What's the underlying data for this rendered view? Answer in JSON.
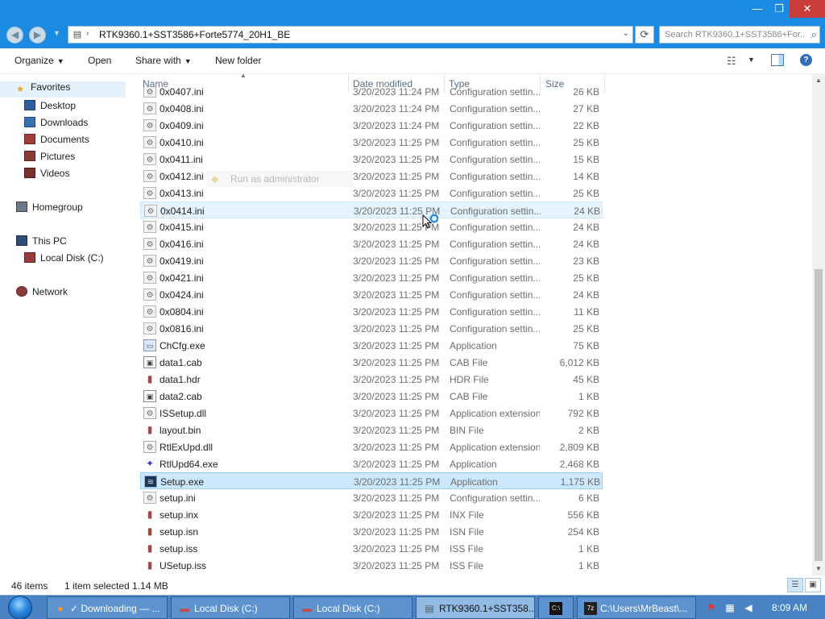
{
  "window": {
    "minimize_glyph": "—",
    "maximize_glyph": "❐",
    "close_glyph": "✕"
  },
  "address": {
    "path": "RTK9360.1+SST3586+Forte5774_20H1_BE",
    "search_placeholder": "Search RTK9360.1+SST3586+For...",
    "back_glyph": "◀",
    "forward_glyph": "▶",
    "recent_glyph": "▼",
    "separator_glyph": "›",
    "dropdown_glyph": "⌄",
    "refresh_glyph": "⟳",
    "search_glyph": "⌕"
  },
  "toolbar": {
    "organize": "Organize",
    "open": "Open",
    "share_with": "Share with",
    "new_folder": "New folder",
    "caret": "▼",
    "view_glyph": "☷",
    "help_glyph": "?"
  },
  "nav": {
    "favorites": "Favorites",
    "desktop": "Desktop",
    "downloads": "Downloads",
    "documents": "Documents",
    "pictures": "Pictures",
    "videos": "Videos",
    "homegroup": "Homegroup",
    "this_pc": "This PC",
    "local_disk": "Local Disk (C:)",
    "network": "Network"
  },
  "columns": {
    "name": "Name",
    "date_modified": "Date modified",
    "type": "Type",
    "size": "Size"
  },
  "files": [
    {
      "name": "0x0407.ini",
      "date": "3/20/2023 11:24 PM",
      "type": "Configuration settin...",
      "size": "26 KB",
      "icon": "ini"
    },
    {
      "name": "0x0408.ini",
      "date": "3/20/2023 11:24 PM",
      "type": "Configuration settin...",
      "size": "27 KB",
      "icon": "ini"
    },
    {
      "name": "0x0409.ini",
      "date": "3/20/2023 11:24 PM",
      "type": "Configuration settin...",
      "size": "22 KB",
      "icon": "ini"
    },
    {
      "name": "0x0410.ini",
      "date": "3/20/2023 11:25 PM",
      "type": "Configuration settin...",
      "size": "25 KB",
      "icon": "ini"
    },
    {
      "name": "0x0411.ini",
      "date": "3/20/2023 11:25 PM",
      "type": "Configuration settin...",
      "size": "15 KB",
      "icon": "ini"
    },
    {
      "name": "0x0412.ini",
      "date": "3/20/2023 11:25 PM",
      "type": "Configuration settin...",
      "size": "14 KB",
      "icon": "ini"
    },
    {
      "name": "0x0413.ini",
      "date": "3/20/2023 11:25 PM",
      "type": "Configuration settin...",
      "size": "25 KB",
      "icon": "ini"
    },
    {
      "name": "0x0414.ini",
      "date": "3/20/2023 11:25 PM",
      "type": "Configuration settin...",
      "size": "24 KB",
      "icon": "ini"
    },
    {
      "name": "0x0415.ini",
      "date": "3/20/2023 11:25 PM",
      "type": "Configuration settin...",
      "size": "24 KB",
      "icon": "ini"
    },
    {
      "name": "0x0416.ini",
      "date": "3/20/2023 11:25 PM",
      "type": "Configuration settin...",
      "size": "24 KB",
      "icon": "ini"
    },
    {
      "name": "0x0419.ini",
      "date": "3/20/2023 11:25 PM",
      "type": "Configuration settin...",
      "size": "23 KB",
      "icon": "ini"
    },
    {
      "name": "0x0421.ini",
      "date": "3/20/2023 11:25 PM",
      "type": "Configuration settin...",
      "size": "25 KB",
      "icon": "ini"
    },
    {
      "name": "0x0424.ini",
      "date": "3/20/2023 11:25 PM",
      "type": "Configuration settin...",
      "size": "24 KB",
      "icon": "ini"
    },
    {
      "name": "0x0804.ini",
      "date": "3/20/2023 11:25 PM",
      "type": "Configuration settin...",
      "size": "11 KB",
      "icon": "ini"
    },
    {
      "name": "0x0816.ini",
      "date": "3/20/2023 11:25 PM",
      "type": "Configuration settin...",
      "size": "25 KB",
      "icon": "ini"
    },
    {
      "name": "ChCfg.exe",
      "date": "3/20/2023 11:25 PM",
      "type": "Application",
      "size": "75 KB",
      "icon": "exe"
    },
    {
      "name": "data1.cab",
      "date": "3/20/2023 11:25 PM",
      "type": "CAB File",
      "size": "6,012 KB",
      "icon": "cab"
    },
    {
      "name": "data1.hdr",
      "date": "3/20/2023 11:25 PM",
      "type": "HDR File",
      "size": "45 KB",
      "icon": "blk"
    },
    {
      "name": "data2.cab",
      "date": "3/20/2023 11:25 PM",
      "type": "CAB File",
      "size": "1 KB",
      "icon": "cab"
    },
    {
      "name": "ISSetup.dll",
      "date": "3/20/2023 11:25 PM",
      "type": "Application extension",
      "size": "792 KB",
      "icon": "dll"
    },
    {
      "name": "layout.bin",
      "date": "3/20/2023 11:25 PM",
      "type": "BIN File",
      "size": "2 KB",
      "icon": "blk"
    },
    {
      "name": "RtlExUpd.dll",
      "date": "3/20/2023 11:25 PM",
      "type": "Application extension",
      "size": "2,809 KB",
      "icon": "dll"
    },
    {
      "name": "RtlUpd64.exe",
      "date": "3/20/2023 11:25 PM",
      "type": "Application",
      "size": "2,468 KB",
      "icon": "rtl"
    },
    {
      "name": "Setup.exe",
      "date": "3/20/2023 11:25 PM",
      "type": "Application",
      "size": "1,175 KB",
      "icon": "setup"
    },
    {
      "name": "setup.ini",
      "date": "3/20/2023 11:25 PM",
      "type": "Configuration settin...",
      "size": "6 KB",
      "icon": "ini"
    },
    {
      "name": "setup.inx",
      "date": "3/20/2023 11:25 PM",
      "type": "INX File",
      "size": "556 KB",
      "icon": "blk"
    },
    {
      "name": "setup.isn",
      "date": "3/20/2023 11:25 PM",
      "type": "ISN File",
      "size": "254 KB",
      "icon": "blk"
    },
    {
      "name": "setup.iss",
      "date": "3/20/2023 11:25 PM",
      "type": "ISS File",
      "size": "1 KB",
      "icon": "blk"
    },
    {
      "name": "USetup.iss",
      "date": "3/20/2023 11:25 PM",
      "type": "ISS File",
      "size": "1 KB",
      "icon": "blk"
    }
  ],
  "ghost_tooltip": "Run as administrator",
  "status": {
    "items": "46 items",
    "selected": "1 item selected  1.14 MB"
  },
  "taskbar": {
    "firefox": "✓ Downloading — ...",
    "disk1": "Local Disk (C:)",
    "disk2": "Local Disk (C:)",
    "explorer": "RTK9360.1+SST358...",
    "cmd": "C:\\Users\\MrBeast\\...",
    "time": "8:09 AM"
  },
  "colors": {
    "accent": "#1a8be0",
    "selection": "#cce8ff",
    "taskbar": "#4a83c3"
  }
}
